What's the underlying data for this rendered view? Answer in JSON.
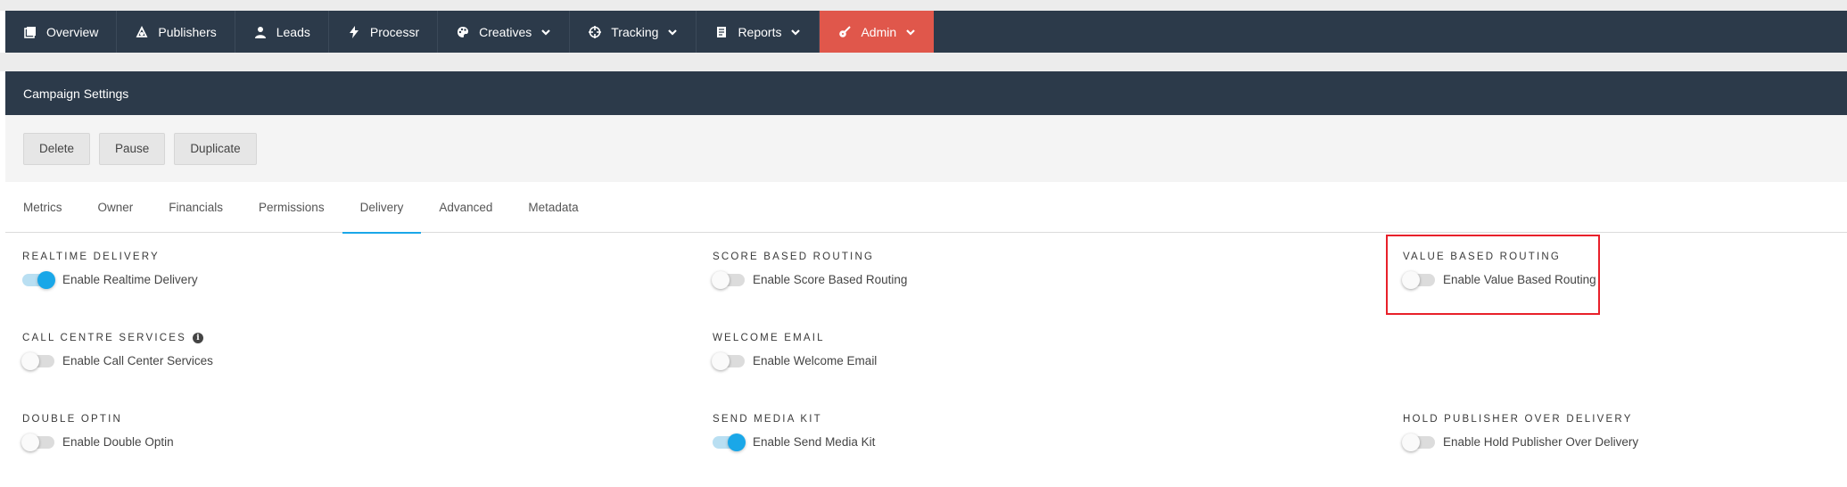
{
  "nav": {
    "items": [
      {
        "label": "Overview",
        "icon": "overview-icon",
        "dropdown": false
      },
      {
        "label": "Publishers",
        "icon": "publishers-icon",
        "dropdown": false
      },
      {
        "label": "Leads",
        "icon": "user-icon",
        "dropdown": false
      },
      {
        "label": "Processr",
        "icon": "bolt-icon",
        "dropdown": false
      },
      {
        "label": "Creatives",
        "icon": "palette-icon",
        "dropdown": true
      },
      {
        "label": "Tracking",
        "icon": "crosshair-icon",
        "dropdown": true
      },
      {
        "label": "Reports",
        "icon": "report-icon",
        "dropdown": true
      },
      {
        "label": "Admin",
        "icon": "guitar-icon",
        "dropdown": true
      }
    ],
    "active": "Admin",
    "active_color": "#e0574b",
    "bg_color": "#2c3a4a"
  },
  "panel": {
    "title": "Campaign Settings"
  },
  "actions": {
    "delete": "Delete",
    "pause": "Pause",
    "duplicate": "Duplicate"
  },
  "tabs": {
    "items": [
      "Metrics",
      "Owner",
      "Financials",
      "Permissions",
      "Delivery",
      "Advanced",
      "Metadata"
    ],
    "active": "Delivery",
    "accent_color": "#1aa7e8"
  },
  "settings": {
    "realtime": {
      "heading": "REALTIME DELIVERY",
      "label": "Enable Realtime Delivery",
      "enabled": true
    },
    "score": {
      "heading": "SCORE BASED ROUTING",
      "label": "Enable Score Based Routing",
      "enabled": false
    },
    "value": {
      "heading": "VALUE BASED ROUTING",
      "label": "Enable Value Based Routing",
      "enabled": false,
      "highlighted": true
    },
    "callcentre": {
      "heading": "CALL CENTRE SERVICES",
      "label": "Enable Call Center Services",
      "enabled": false,
      "info_icon": "info-icon"
    },
    "welcome": {
      "heading": "WELCOME EMAIL",
      "label": "Enable Welcome Email",
      "enabled": false
    },
    "double": {
      "heading": "DOUBLE OPTIN",
      "label": "Enable Double Optin",
      "enabled": false
    },
    "mediakit": {
      "heading": "SEND MEDIA KIT",
      "label": "Enable Send Media Kit",
      "enabled": true
    },
    "hold": {
      "heading": "HOLD PUBLISHER OVER DELIVERY",
      "label": "Enable Hold Publisher Over Delivery",
      "enabled": false
    }
  },
  "highlight_color": "#e8202a"
}
